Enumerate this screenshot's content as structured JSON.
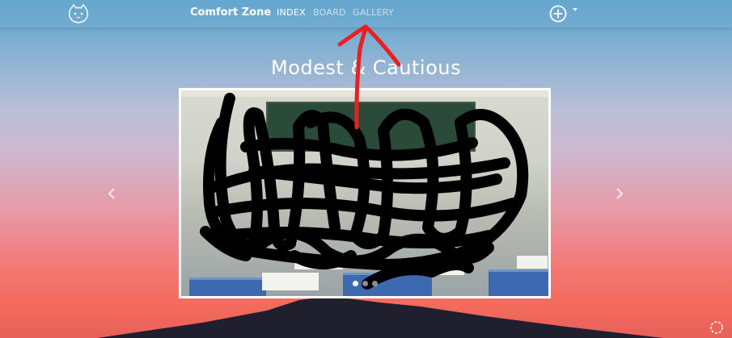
{
  "navbar": {
    "brand": "Comfort Zone",
    "links": [
      {
        "label": "INDEX",
        "active": true
      },
      {
        "label": "BOARD",
        "active": false
      },
      {
        "label": "GALLERY",
        "active": false
      }
    ],
    "logo_icon": "cat-face-icon",
    "add_icon": "plus-circle-icon"
  },
  "gallery": {
    "title": "Modest & Cautious",
    "slide_count": 3,
    "active_slide": 1,
    "prev_icon": "chevron-left-icon",
    "next_icon": "chevron-right-icon"
  },
  "colors": {
    "annotation_arrow": "#e8201f",
    "redaction_scribble": "#000000",
    "sky_top": "#5aa6cf",
    "sky_bottom": "#e8615a",
    "mountain": "#1f1f2e"
  }
}
